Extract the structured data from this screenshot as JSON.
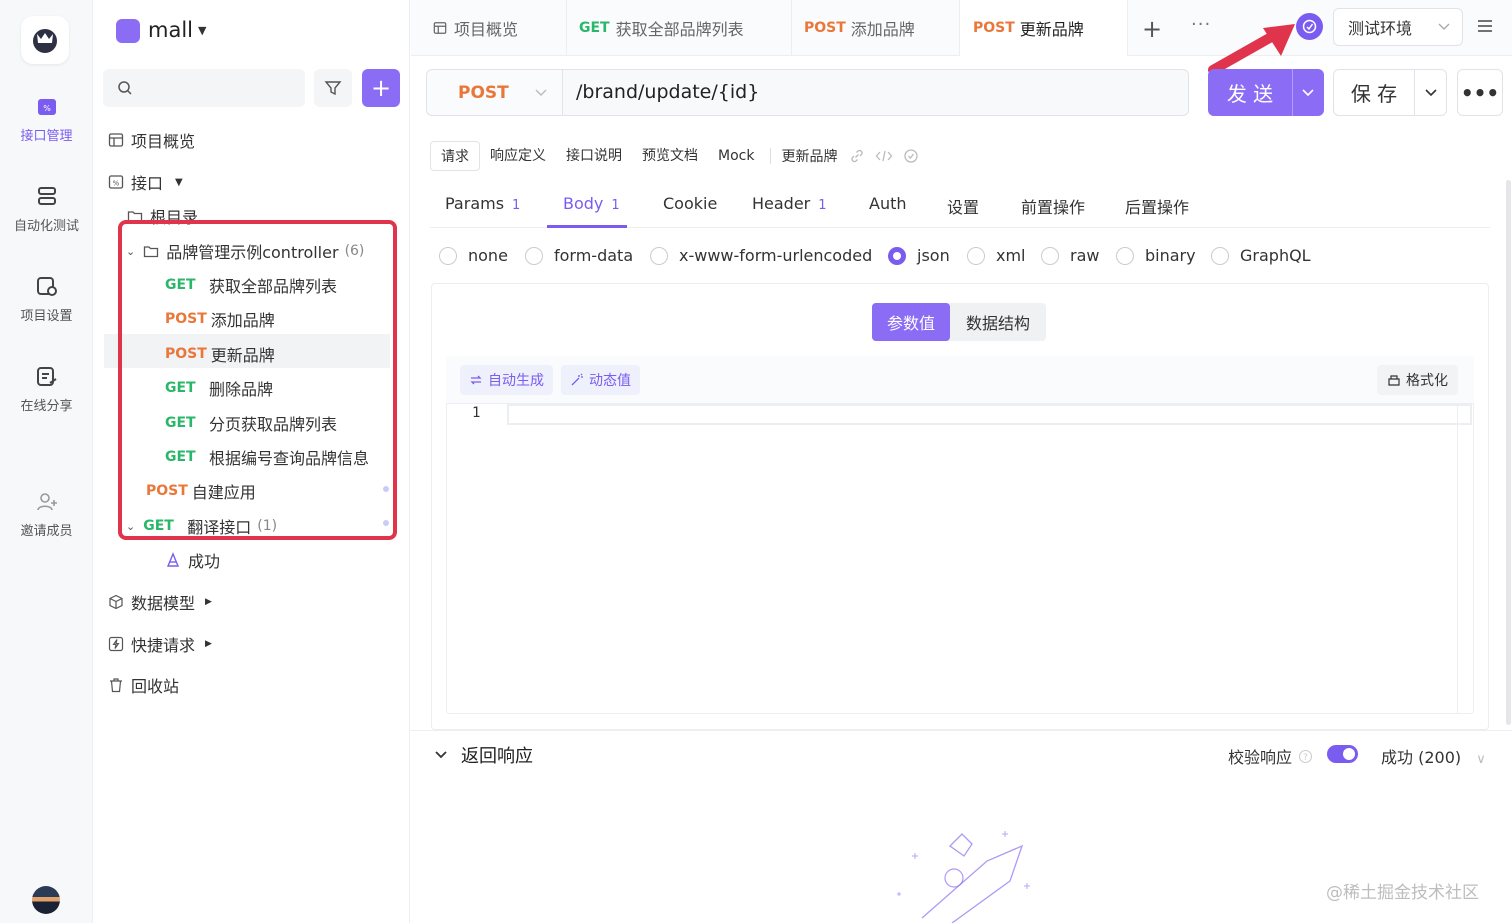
{
  "rail": {
    "items": [
      {
        "label": "接口管理",
        "icon": "api-icon"
      },
      {
        "label": "自动化测试",
        "icon": "automation-icon"
      },
      {
        "label": "项目设置",
        "icon": "project-settings-icon"
      },
      {
        "label": "在线分享",
        "icon": "share-icon"
      },
      {
        "label": "邀请成员",
        "icon": "invite-member-icon"
      }
    ]
  },
  "sidebar": {
    "project_name": "mall",
    "overview": "项目概览",
    "api_root": "接口",
    "root_folder": "根目录",
    "folder": {
      "name": "品牌管理示例controller",
      "count": "(6)"
    },
    "endpoints": [
      {
        "method": "GET",
        "name": "获取全部品牌列表"
      },
      {
        "method": "POST",
        "name": "添加品牌"
      },
      {
        "method": "POST",
        "name": "更新品牌"
      },
      {
        "method": "GET",
        "name": "删除品牌"
      },
      {
        "method": "GET",
        "name": "分页获取品牌列表"
      },
      {
        "method": "GET",
        "name": "根据编号查询品牌信息"
      }
    ],
    "extra_endpoints": [
      {
        "method": "POST",
        "name": "自建应用"
      },
      {
        "method": "GET",
        "name": "翻译接口",
        "count": "(1)"
      }
    ],
    "case_name": "成功",
    "sections": [
      "数据模型",
      "快捷请求",
      "回收站"
    ]
  },
  "tabs": [
    {
      "method": "",
      "label": "项目概览"
    },
    {
      "method": "GET",
      "label": "获取全部品牌列表"
    },
    {
      "method": "POST",
      "label": "添加品牌"
    },
    {
      "method": "POST",
      "label": "更新品牌"
    }
  ],
  "environment": "测试环境",
  "request": {
    "method": "POST",
    "url": "/brand/update/{id}",
    "send_label": "发 送",
    "save_label": "保 存"
  },
  "subtabs": [
    "请求",
    "响应定义",
    "接口说明",
    "预览文档",
    "Mock",
    "更新品牌"
  ],
  "param_tabs": [
    {
      "label": "Params",
      "count": "1"
    },
    {
      "label": "Body",
      "count": "1"
    },
    {
      "label": "Cookie",
      "count": ""
    },
    {
      "label": "Header",
      "count": "1"
    },
    {
      "label": "Auth",
      "count": ""
    },
    {
      "label": "设置",
      "count": ""
    },
    {
      "label": "前置操作",
      "count": ""
    },
    {
      "label": "后置操作",
      "count": ""
    }
  ],
  "body_types": [
    "none",
    "form-data",
    "x-www-form-urlencoded",
    "json",
    "xml",
    "raw",
    "binary",
    "GraphQL"
  ],
  "body_selected": "json",
  "segment": {
    "value": "参数值",
    "schema": "数据结构"
  },
  "editor": {
    "auto_gen": "自动生成",
    "dynamic": "动态值",
    "format": "格式化",
    "line": "1"
  },
  "response": {
    "title": "返回响应",
    "validate": "校验响应",
    "status": "成功 (200)"
  },
  "watermark": "@稀土掘金技术社区",
  "colors": {
    "accent": "#8b6cf5",
    "get": "#2bb76a",
    "post": "#e9773a",
    "highlight": "#e0344d"
  }
}
